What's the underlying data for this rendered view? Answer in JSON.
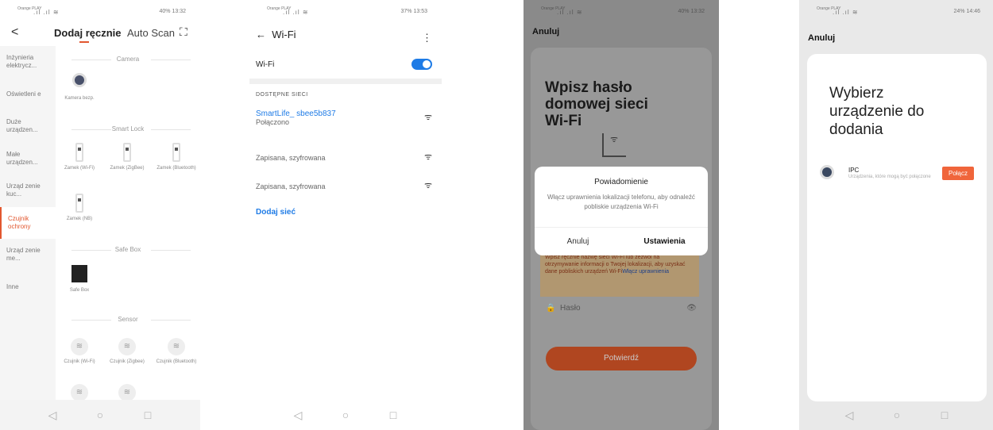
{
  "p1": {
    "status": {
      "carrier": "Orange PLAY",
      "battery": "40% 13:32"
    },
    "back": "<",
    "tab_manual": "Dodaj ręcznie",
    "tab_scan": "Auto Scan",
    "scan_icon": "⛶",
    "sidebar": [
      "Inżynieria elektrycz...",
      "Oświetleni e",
      "Duże urządzen...",
      "Małe urządzen...",
      "Urząd zenie kuc...",
      "Czujnik ochrony",
      "Urząd zenie me...",
      "Inne"
    ],
    "sections": {
      "camera": "Camera",
      "lock": "Smart Lock",
      "safe": "Safe Box",
      "sensor": "Sensor"
    },
    "items": {
      "cam": "Kamera bezp.",
      "l1": "Zamek (Wi-Fi)",
      "l2": "Zamek (ZigBee)",
      "l3": "Zamek (Bluetooth)",
      "l4": "Zamek (NB)",
      "safe": "Safe Box",
      "s1": "Czujnik (Wi-Fi)",
      "s2": "Czujnik (Zigbee)",
      "s3": "Czujnik (Bluetooth)"
    },
    "sensor_icon": "≋"
  },
  "p2": {
    "status": {
      "carrier": "Orange PLAY",
      "battery": "37% 13:53"
    },
    "back": "←",
    "title": "Wi-Fi",
    "menu": "⋮",
    "wifi_label": "Wi-Fi",
    "section": "DOSTĘPNE SIECI",
    "networks": [
      {
        "name": "SmartLife_ sbee5b837",
        "status": "Połączono"
      },
      {
        "name": "",
        "status": "Zapisana, szyfrowana"
      },
      {
        "name": "",
        "status": "Zapisana, szyfrowana"
      }
    ],
    "add": "Dodaj sieć",
    "wifi_icon": "ᯤ"
  },
  "p3": {
    "status": {
      "carrier": "Orange PLAY",
      "battery": "40% 13:32"
    },
    "cancel": "Anuluj",
    "title_l1": "Wpisz hasło",
    "title_l2": "domowej sieci",
    "title_l3": "Wi-Fi",
    "router_icon": "ᯤ",
    "dialog": {
      "title": "Powiadomienie",
      "message": "Włącz uprawnienia lokalizacji telefonu, aby odnaleźć pobliskie urządzenia Wi-Fi",
      "cancel": "Anuluj",
      "settings": "Ustawienia"
    },
    "warning": "Wpisz ręcznie nazwę sieci Wi-Fi lub zezwól na otrzymywanie informacji o Twojej lokalizacji, aby uzyskać dane pobliskich urządzeń Wi-Fi",
    "warning_link": "Włącz uprawnienia",
    "password": "Hasło",
    "lock_icon": "🔒",
    "eye_icon": "👁",
    "confirm": "Potwierdź"
  },
  "p4": {
    "status": {
      "carrier": "Orange PLAY",
      "battery": "24% 14:46"
    },
    "cancel": "Anuluj",
    "title_l1": "Wybierz",
    "title_l2": "urządzenie do",
    "title_l3": "dodania",
    "device": {
      "name": "IPC",
      "desc": "Urządzenia, które mogą być połączone",
      "button": "Połącz"
    }
  },
  "nav": {
    "back": "◁",
    "home": "○",
    "recent": "□"
  }
}
